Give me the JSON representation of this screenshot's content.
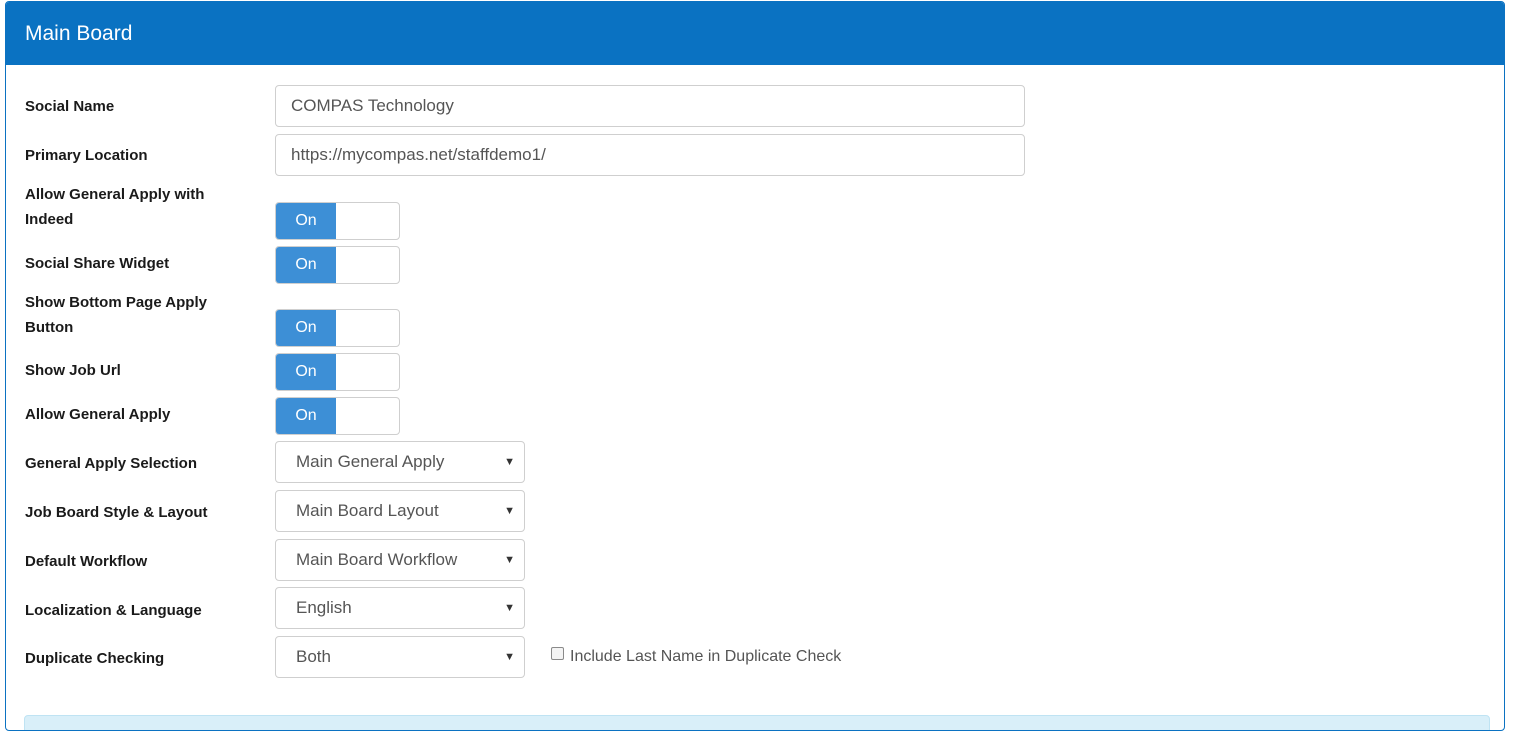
{
  "panel": {
    "title": "Main Board"
  },
  "fields": {
    "social_name": {
      "label": "Social Name",
      "value": "COMPAS Technology"
    },
    "primary_location": {
      "label": "Primary Location",
      "value": "https://mycompas.net/staffdemo1/"
    },
    "allow_general_apply_indeed": {
      "label": "Allow General Apply with Indeed",
      "state": "On"
    },
    "social_share_widget": {
      "label": "Social Share Widget",
      "state": "On"
    },
    "show_bottom_apply": {
      "label": "Show Bottom Page Apply Button",
      "state": "On"
    },
    "show_job_url": {
      "label": "Show Job Url",
      "state": "On"
    },
    "allow_general_apply": {
      "label": "Allow General Apply",
      "state": "On"
    },
    "general_apply_selection": {
      "label": "General Apply Selection",
      "value": "Main General Apply"
    },
    "job_board_style": {
      "label": "Job Board Style & Layout",
      "value": "Main Board Layout"
    },
    "default_workflow": {
      "label": "Default Workflow",
      "value": "Main Board Workflow"
    },
    "localization": {
      "label": "Localization & Language",
      "value": "English"
    },
    "duplicate_checking": {
      "label": "Duplicate Checking",
      "value": "Both"
    },
    "include_last_name": {
      "label": "Include Last Name in Duplicate Check",
      "checked": false
    }
  },
  "colors": {
    "header": "#0a72c2",
    "toggle_on": "#3d8fd6",
    "info_bar": "#d9eff9"
  }
}
